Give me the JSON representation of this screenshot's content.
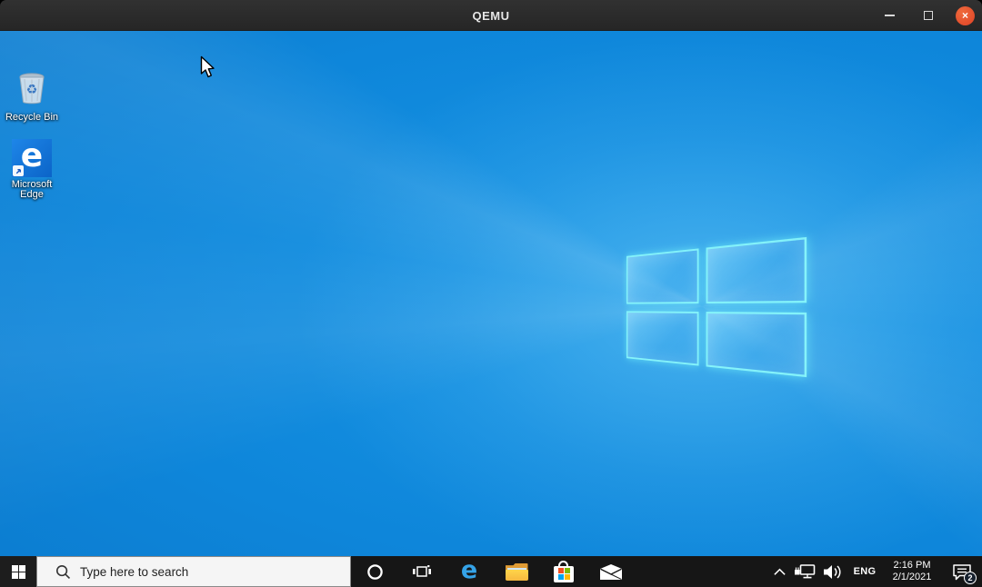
{
  "window": {
    "title": "QEMU",
    "controls": {
      "minimize_icon": "minimize-icon",
      "maximize_icon": "maximize-icon",
      "close_icon": "close-icon",
      "close_glyph": "×"
    }
  },
  "desktop": {
    "icons": [
      {
        "name": "recycle-bin",
        "icon": "recycle-bin-icon",
        "label": "Recycle Bin"
      },
      {
        "name": "microsoft-edge-shortcut",
        "icon": "edge-tile-icon",
        "glyph": "e",
        "label": "Microsoft Edge"
      }
    ],
    "wallpaper": {
      "description": "windows-10-light-logo-wallpaper",
      "base_color": "#0e86da",
      "glow_color": "#7df0f6"
    }
  },
  "taskbar": {
    "start": {
      "icon": "windows-start-icon"
    },
    "search": {
      "icon": "search-icon",
      "placeholder": "Type here to search"
    },
    "apps": [
      {
        "name": "cortana",
        "icon": "cortana-circle-icon"
      },
      {
        "name": "task-view",
        "icon": "task-view-icon"
      },
      {
        "name": "microsoft-edge",
        "icon": "edge-e-icon",
        "glyph": "e"
      },
      {
        "name": "file-explorer",
        "icon": "folder-icon"
      },
      {
        "name": "microsoft-store",
        "icon": "store-bag-icon"
      },
      {
        "name": "mail",
        "icon": "mail-envelope-icon"
      }
    ],
    "tray": {
      "hidden_icons": {
        "icon": "chevron-up-icon"
      },
      "network": {
        "icon": "network-ethernet-icon"
      },
      "volume": {
        "icon": "speaker-volume-icon"
      },
      "language": "ENG",
      "time": "2:16 PM",
      "date": "2/1/2021",
      "action_center": {
        "icon": "action-center-icon",
        "notification_badge": "2"
      }
    }
  },
  "colors": {
    "titlebar": "#2b2b2b",
    "taskbar": "#161616",
    "wallpaper_blue": "#0e86da",
    "close_button_red": "#df4226",
    "edge_blue": "#0b64c8",
    "store_grid": [
      "#f25022",
      "#7fba00",
      "#00a4ef",
      "#ffb900"
    ]
  }
}
